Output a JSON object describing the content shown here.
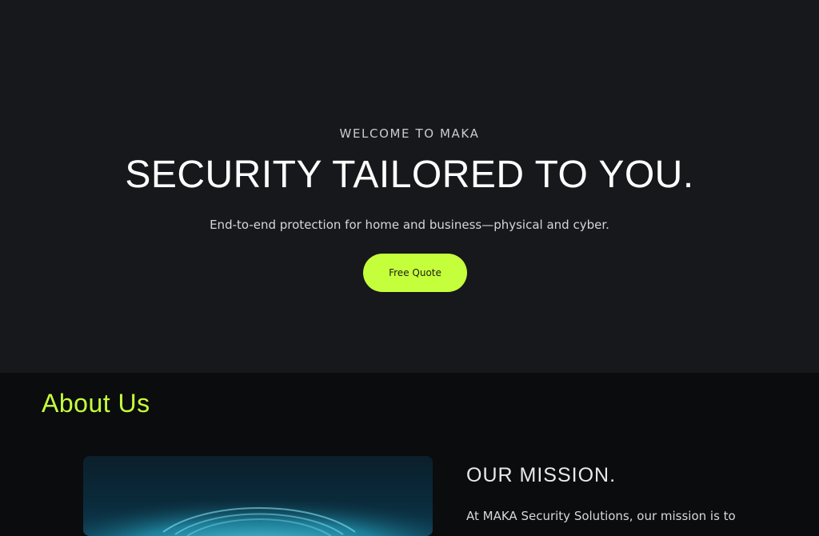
{
  "hero": {
    "eyebrow": "WELCOME TO MAKA",
    "title": "SECURITY TAILORED TO YOU.",
    "subtitle": "End-to-end protection for home and business—physical and cyber.",
    "cta_label": "Free Quote"
  },
  "about": {
    "heading": "About Us",
    "mission_heading": "OUR MISSION.",
    "mission_text": "At MAKA Security Solutions, our mission is to"
  },
  "colors": {
    "accent": "#c5ff3b",
    "hero_bg": "#16181b",
    "section_bg": "#0b0c0d"
  }
}
